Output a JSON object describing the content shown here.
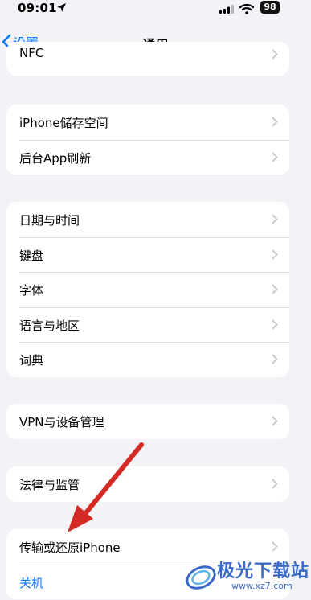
{
  "status_bar": {
    "time": "09:01",
    "battery": "98"
  },
  "nav": {
    "back_label": "设置",
    "title": "通用"
  },
  "groups": [
    {
      "items": [
        {
          "label": "NFC"
        }
      ]
    },
    {
      "items": [
        {
          "label": "iPhone储存空间"
        },
        {
          "label": "后台App刷新"
        }
      ]
    },
    {
      "items": [
        {
          "label": "日期与时间"
        },
        {
          "label": "键盘"
        },
        {
          "label": "字体"
        },
        {
          "label": "语言与地区"
        },
        {
          "label": "词典"
        }
      ]
    },
    {
      "items": [
        {
          "label": "VPN与设备管理"
        }
      ]
    },
    {
      "items": [
        {
          "label": "法律与监管"
        }
      ]
    },
    {
      "items": [
        {
          "label": "传输或还原iPhone"
        },
        {
          "label": "关机"
        }
      ]
    }
  ],
  "watermark": {
    "text": "极光下载站",
    "url": "www.xz7.com"
  },
  "colors": {
    "accent": "#0a7aff",
    "background": "#f2f2f7",
    "annotation_arrow": "#d42a25"
  }
}
